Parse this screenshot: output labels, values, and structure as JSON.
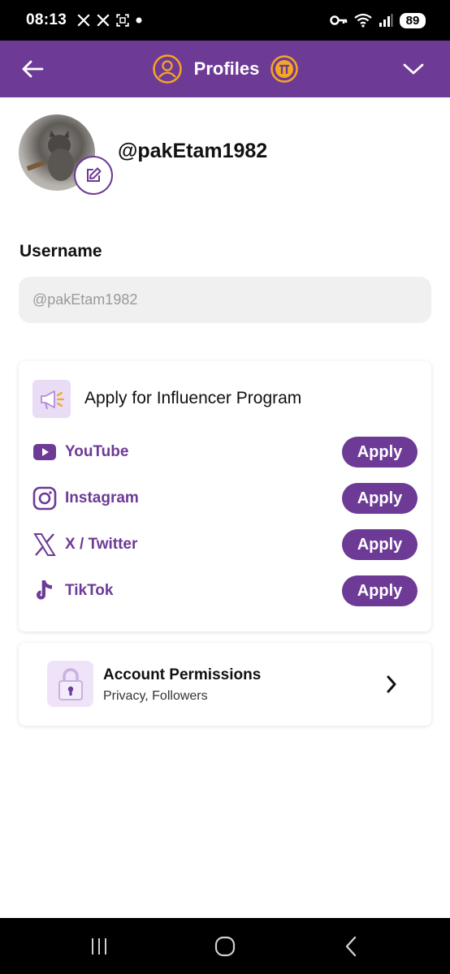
{
  "status_bar": {
    "time": "08:13",
    "notification_icons": [
      "x-logo-icon",
      "x-logo-icon",
      "screenshot-icon",
      "dot-icon"
    ],
    "system_icons": [
      "key-icon",
      "wifi-icon",
      "signal-icon"
    ],
    "battery": "89"
  },
  "header": {
    "title": "Profiles",
    "background_color": "#6d3a96",
    "accent_color": "#f5a623"
  },
  "profile": {
    "handle": "@pakEtam1982"
  },
  "username": {
    "label": "Username",
    "value": "@pakEtam1982"
  },
  "influencer": {
    "title": "Apply for Influencer Program",
    "platforms": [
      {
        "name": "YouTube",
        "icon": "youtube-icon",
        "button": "Apply"
      },
      {
        "name": "Instagram",
        "icon": "instagram-icon",
        "button": "Apply"
      },
      {
        "name": "X / Twitter",
        "icon": "x-twitter-icon",
        "button": "Apply"
      },
      {
        "name": "TikTok",
        "icon": "tiktok-icon",
        "button": "Apply"
      }
    ]
  },
  "permissions": {
    "title": "Account Permissions",
    "subtitle": "Privacy, Followers"
  }
}
